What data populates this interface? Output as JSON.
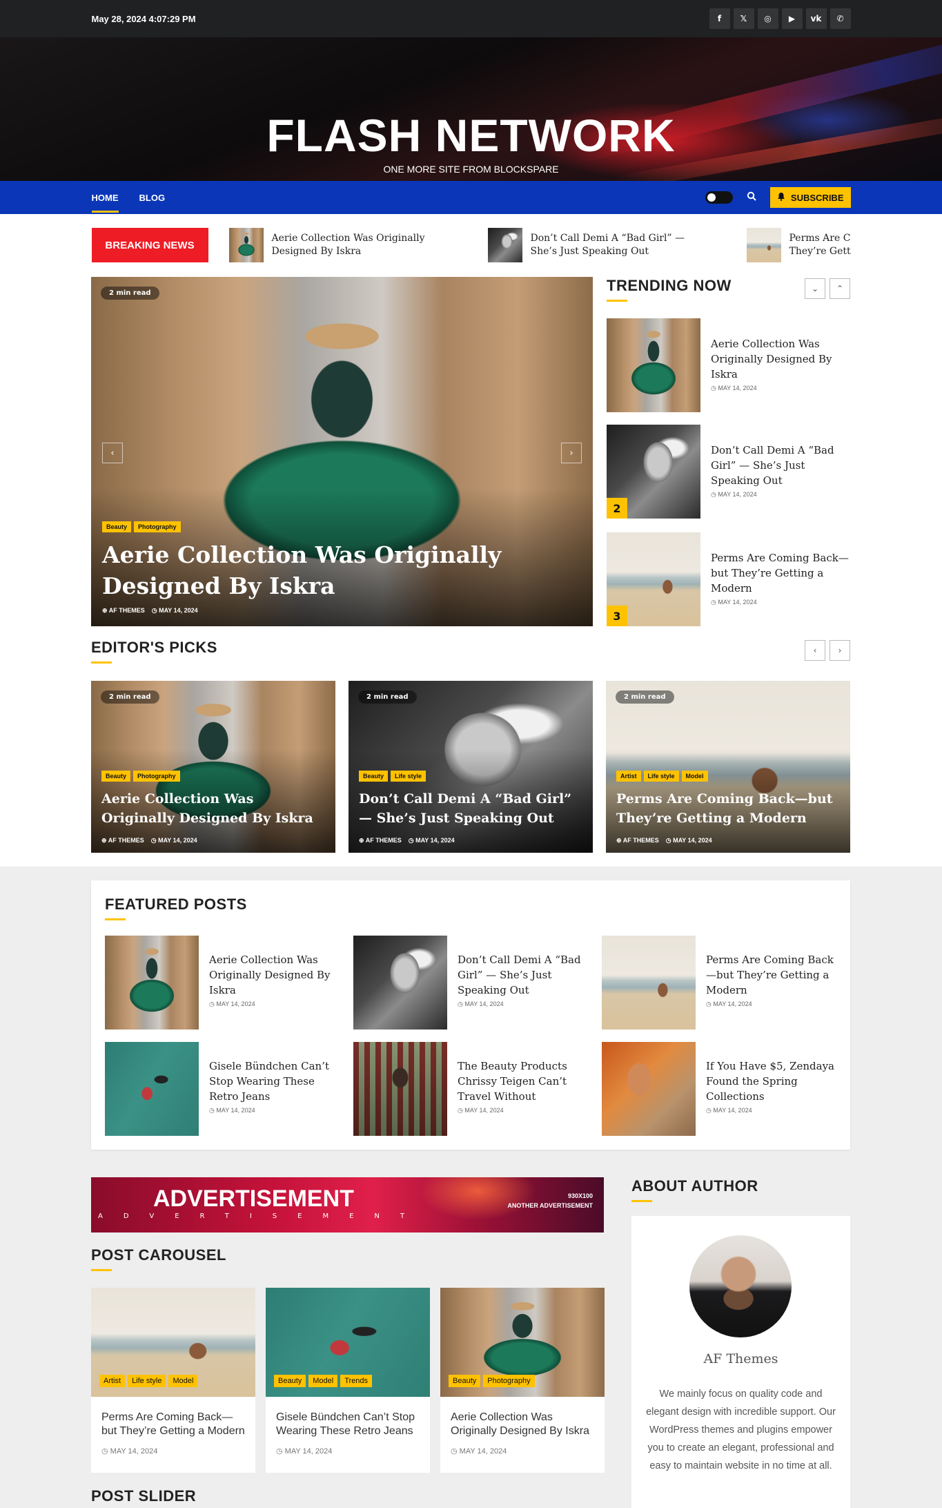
{
  "topbar": {
    "datetime": "May 28, 2024 4:07:29 PM",
    "social": [
      {
        "icon": "facebook-icon",
        "glyph": "f"
      },
      {
        "icon": "x-icon",
        "glyph": "𝕏"
      },
      {
        "icon": "instagram-icon",
        "glyph": "◎"
      },
      {
        "icon": "youtube-icon",
        "glyph": "▶"
      },
      {
        "icon": "vk-icon",
        "glyph": "vk"
      },
      {
        "icon": "whatsapp-icon",
        "glyph": "✆"
      }
    ]
  },
  "header": {
    "site_title": "FLASH NETWORK",
    "tagline": "ONE MORE SITE FROM BLOCKSPARE"
  },
  "nav": {
    "items": [
      {
        "label": "HOME",
        "active": true
      },
      {
        "label": "BLOG",
        "active": false
      }
    ],
    "subscribe_label": "SUBSCRIBE"
  },
  "breaking": {
    "label": "BREAKING NEWS",
    "items": [
      {
        "title": "Aerie Collection Was Originally Designed By Iskra"
      },
      {
        "title": "Don’t Call Demi A “Bad Girl” — She’s Just Speaking Out"
      },
      {
        "title": "Perms Are Coming Back—but They’re Getting a Modern"
      }
    ]
  },
  "hero": {
    "read_time": "2 min read",
    "categories": [
      "Beauty",
      "Photography"
    ],
    "title": "Aerie Collection Was Originally Designed By Iskra",
    "author": "AF THEMES",
    "date": "MAY 14, 2024",
    "prev": "‹",
    "next": "›"
  },
  "trending": {
    "title": "TRENDING NOW",
    "items": [
      {
        "title": "Aerie Collection Was Originally Designed By Iskra",
        "date": "MAY 14, 2024",
        "num": ""
      },
      {
        "title": "Don’t Call Demi A “Bad Girl” — She’s Just Speaking Out",
        "date": "MAY 14, 2024",
        "num": "2"
      },
      {
        "title": "Perms Are Coming Back—but They’re Getting a Modern",
        "date": "MAY 14, 2024",
        "num": "3"
      }
    ]
  },
  "editors": {
    "title": "EDITOR'S PICKS",
    "items": [
      {
        "read_time": "2 min read",
        "categories": [
          "Beauty",
          "Photography"
        ],
        "title": "Aerie Collection Was Originally Designed By Iskra",
        "author": "AF THEMES",
        "date": "MAY 14, 2024"
      },
      {
        "read_time": "2 min read",
        "categories": [
          "Beauty",
          "Life style"
        ],
        "title": "Don’t Call Demi A “Bad Girl” — She’s Just Speaking Out",
        "author": "AF THEMES",
        "date": "MAY 14, 2024"
      },
      {
        "read_time": "2 min read",
        "categories": [
          "Artist",
          "Life style",
          "Model"
        ],
        "title": "Perms Are Coming Back—but They’re Getting a Modern",
        "author": "AF THEMES",
        "date": "MAY 14, 2024"
      }
    ]
  },
  "featured": {
    "title": "FEATURED POSTS",
    "items": [
      {
        "title": "Aerie Collection Was Originally Designed By Iskra",
        "date": "MAY 14, 2024"
      },
      {
        "title": "Don’t Call Demi A “Bad Girl” — She’s Just Speaking Out",
        "date": "MAY 14, 2024"
      },
      {
        "title": "Perms Are Coming Back—but They’re Getting a Modern",
        "date": "MAY 14, 2024"
      },
      {
        "title": "Gisele Bündchen Can’t Stop Wearing These Retro Jeans",
        "date": "MAY 14, 2024"
      },
      {
        "title": "The Beauty Products Chrissy Teigen Can’t Travel Without",
        "date": "MAY 14, 2024"
      },
      {
        "title": "If You Have $5, Zendaya Found the Spring Collections",
        "date": "MAY 14, 2024"
      }
    ]
  },
  "ad": {
    "title": "ADVERTISEMENT",
    "subtitle": "ADVERTISEMENT",
    "size": "930X100",
    "another": "ANOTHER ADVERTISEMENT"
  },
  "carousel": {
    "title": "POST CAROUSEL",
    "items": [
      {
        "categories": [
          "Artist",
          "Life style",
          "Model"
        ],
        "title": "Perms Are Coming Back—but They’re Getting a Modern",
        "date": "MAY 14, 2024"
      },
      {
        "categories": [
          "Beauty",
          "Model",
          "Trends"
        ],
        "title": "Gisele Bündchen Can’t Stop Wearing These Retro Jeans",
        "date": "MAY 14, 2024"
      },
      {
        "categories": [
          "Beauty",
          "Photography"
        ],
        "title": "Aerie Collection Was Originally Designed By Iskra",
        "date": "MAY 14, 2024"
      }
    ]
  },
  "slider": {
    "title": "POST SLIDER"
  },
  "about": {
    "title": "ABOUT AUTHOR",
    "name": "AF Themes",
    "bio": "We mainly focus on quality code and elegant design with incredible support. Our WordPress themes and plugins empower you to create an elegant, professional and easy to maintain website in no time at all."
  },
  "colors": {
    "accent": "#ffc200",
    "nav": "#0a36b7",
    "breaking": "#ee1c25",
    "topbar": "#1f2122"
  }
}
